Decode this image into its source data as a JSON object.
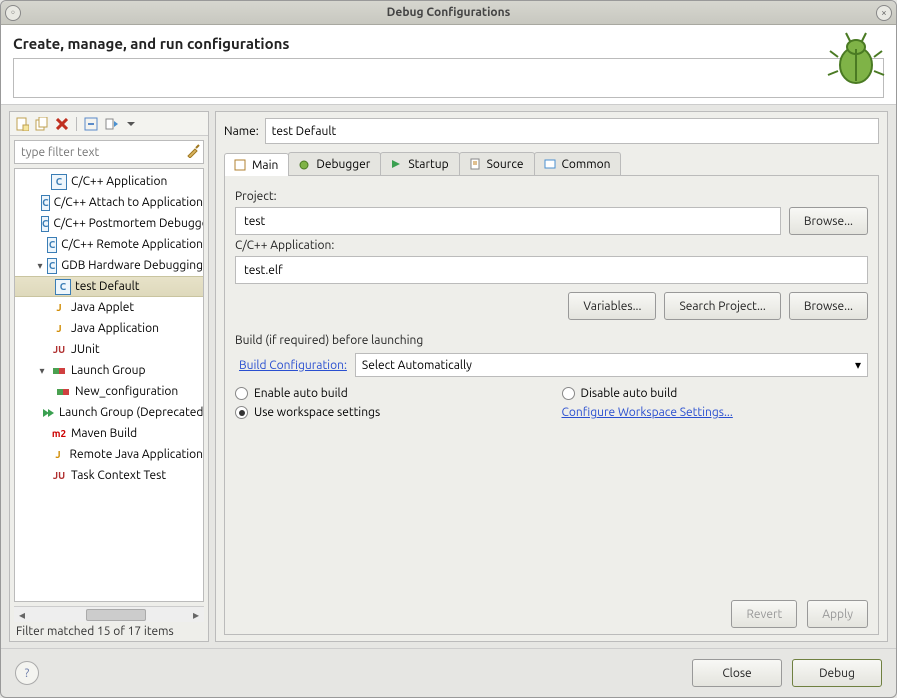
{
  "window": {
    "title": "Debug Configurations"
  },
  "header": {
    "heading": "Create, manage, and run configurations",
    "message": ""
  },
  "toolbar": {
    "new_tip": "New",
    "duplicate_tip": "Duplicate",
    "delete_tip": "Delete",
    "collapse_tip": "Collapse All",
    "expand_tip": "Expand",
    "filter_tip": "Filter"
  },
  "filter": {
    "placeholder": "type filter text"
  },
  "tree": {
    "items": [
      {
        "icon": "c",
        "label": "C/C++ Application",
        "indent": 1
      },
      {
        "icon": "c",
        "label": "C/C++ Attach to Application",
        "indent": 1
      },
      {
        "icon": "c",
        "label": "C/C++ Postmortem Debugger",
        "indent": 1
      },
      {
        "icon": "c",
        "label": "C/C++ Remote Application",
        "indent": 1
      },
      {
        "icon": "c",
        "label": "GDB Hardware Debugging",
        "indent": 1,
        "expander": "▾"
      },
      {
        "icon": "c",
        "label": "test Default",
        "indent": 2,
        "selected": true
      },
      {
        "icon": "j",
        "label": "Java Applet",
        "indent": 1
      },
      {
        "icon": "j",
        "label": "Java Application",
        "indent": 1
      },
      {
        "icon": "ju",
        "label": "JUnit",
        "indent": 1
      },
      {
        "icon": "lg",
        "label": "Launch Group",
        "indent": 1,
        "expander": "▾"
      },
      {
        "icon": "lg",
        "label": "New_configuration",
        "indent": 2
      },
      {
        "icon": "lgd",
        "label": "Launch Group (Deprecated)",
        "indent": 1
      },
      {
        "icon": "m2",
        "label": "Maven Build",
        "indent": 1
      },
      {
        "icon": "rj",
        "label": "Remote Java Application",
        "indent": 1
      },
      {
        "icon": "tct",
        "label": "Task Context Test",
        "indent": 1
      }
    ]
  },
  "status": "Filter matched 15 of 17 items",
  "form": {
    "name_label": "Name:",
    "name_value": "test Default",
    "tabs": {
      "main": "Main",
      "debugger": "Debugger",
      "startup": "Startup",
      "source": "Source",
      "common": "Common"
    },
    "project_label": "Project:",
    "project_value": "test",
    "browse": "Browse...",
    "app_label": "C/C++ Application:",
    "app_value": "test.elf",
    "variables": "Variables...",
    "search_project": "Search Project...",
    "build_section": "Build (if required) before launching",
    "build_config_label": "Build Configuration:",
    "build_config_value": "Select Automatically",
    "r_enable": "Enable auto build",
    "r_disable": "Disable auto build",
    "r_workspace": "Use workspace settings",
    "configure_link": "Configure Workspace Settings...",
    "revert": "Revert",
    "apply": "Apply"
  },
  "footer": {
    "close": "Close",
    "debug": "Debug"
  }
}
